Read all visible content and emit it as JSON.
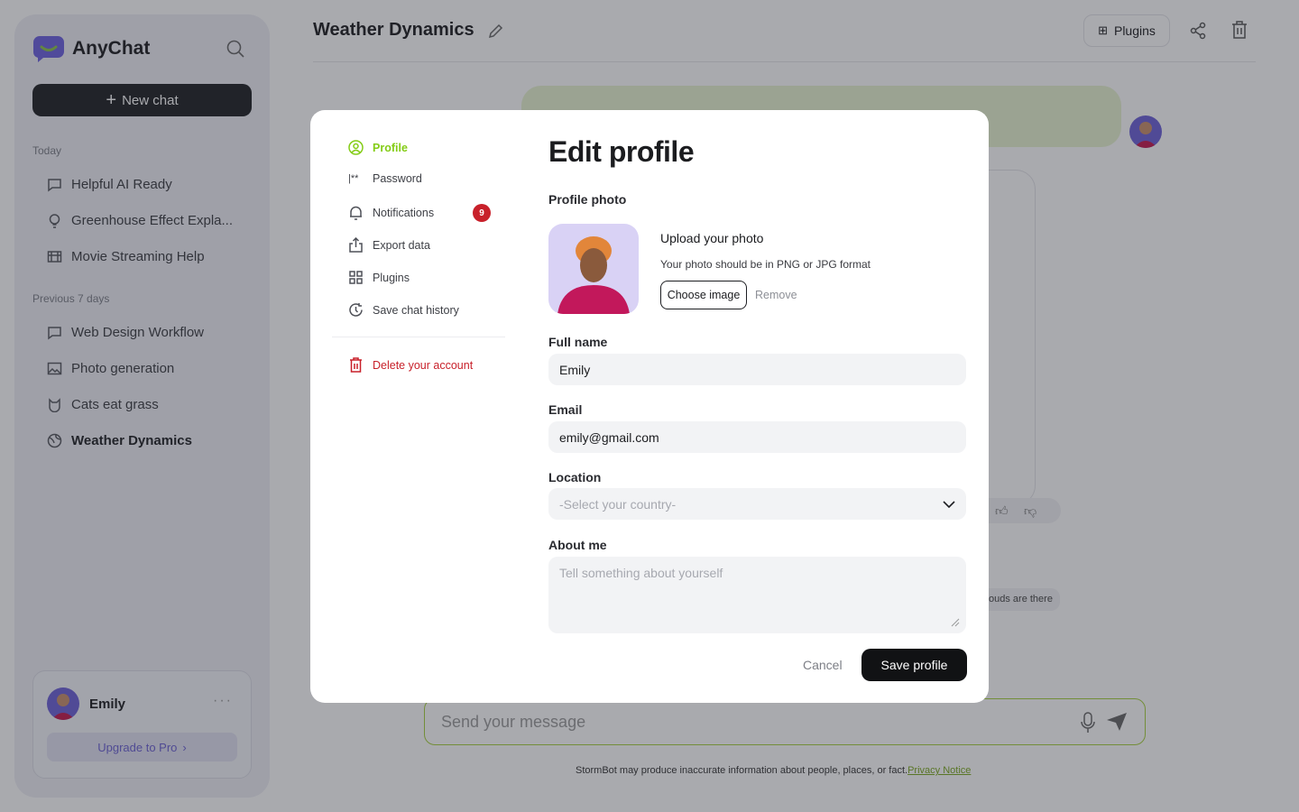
{
  "app": {
    "name": "AnyChat",
    "new_chat": "New chat"
  },
  "sidebar": {
    "sections": [
      {
        "label": "Today",
        "items": [
          "Helpful AI Ready",
          "Greenhouse Effect Expla...",
          "Movie Streaming Help"
        ]
      },
      {
        "label": "Previous 7 days",
        "items": [
          "Web Design Workflow",
          "Photo generation",
          "Cats eat grass",
          "Weather Dynamics"
        ]
      }
    ],
    "user": {
      "name": "Emily",
      "upgrade": "Upgrade to Pro"
    }
  },
  "header": {
    "title": "Weather Dynamics",
    "plugins": "Plugins"
  },
  "chat": {
    "chip": "ouds are there",
    "input_placeholder": "Send your message",
    "disclaimer": "StormBot may produce inaccurate information about people, places, or fact.",
    "privacy": "Privacy Notice"
  },
  "modal": {
    "nav": [
      {
        "label": "Profile",
        "icon": "user-circle-icon",
        "active": true
      },
      {
        "label": "Password",
        "icon": "password-icon"
      },
      {
        "label": "Notifications",
        "icon": "bell-icon",
        "badge": "9"
      },
      {
        "label": "Export data",
        "icon": "export-icon"
      },
      {
        "label": "Plugins",
        "icon": "grid-icon"
      },
      {
        "label": "Save chat history",
        "icon": "history-icon"
      }
    ],
    "delete": "Delete your account",
    "title": "Edit profile",
    "photo_label": "Profile photo",
    "upload_title": "Upload your photo",
    "upload_hint": "Your photo should be in PNG or JPG format",
    "choose": "Choose image",
    "remove": "Remove",
    "fullname_label": "Full name",
    "fullname": "Emily",
    "email_label": "Email",
    "email": "emily@gmail.com",
    "location_label": "Location",
    "location_placeholder": "-Select your country-",
    "about_label": "About me",
    "about_placeholder": "Tell something about yourself",
    "cancel": "Cancel",
    "save": "Save profile"
  },
  "colors": {
    "accent": "#84cc16",
    "danger": "#c8202a",
    "dark": "#1d1e22"
  }
}
